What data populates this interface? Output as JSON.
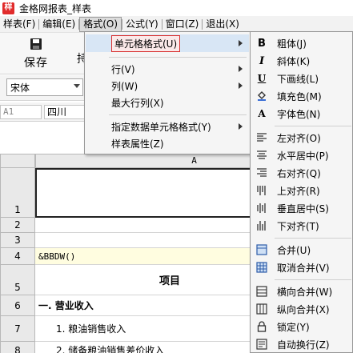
{
  "window": {
    "title": "金格网报表_样表",
    "app_icon_glyph": "样"
  },
  "menubar": {
    "items": [
      {
        "label": "样表(F)"
      },
      {
        "label": "编辑(E)"
      },
      {
        "label": "格式(O)"
      },
      {
        "label": "公式(Y)"
      },
      {
        "label": "窗口(Z)"
      },
      {
        "label": "退出(X)"
      }
    ]
  },
  "toolbar": {
    "save_label": "保存",
    "partial_label": "持"
  },
  "fontbar": {
    "font_value": "宋体"
  },
  "formula_bar": {
    "cell_ref": "A1",
    "formula_value": "四川"
  },
  "sheet": {
    "column_header": "A",
    "rows": [
      {
        "num": "1",
        "text": ""
      },
      {
        "num": "2",
        "text": ""
      },
      {
        "num": "3",
        "text": ""
      },
      {
        "num": "4",
        "text": "&BBDW()"
      },
      {
        "num": "5",
        "text": "项目"
      },
      {
        "num": "6",
        "text": "一. 营业收入"
      },
      {
        "num": "7",
        "text": "1. 粮油销售收入"
      },
      {
        "num": "8",
        "text": "2. 储备粮油销售差价收入"
      }
    ]
  },
  "format_menu": {
    "items": [
      {
        "label": "单元格格式(U)",
        "submenu": true,
        "highlighted": true
      },
      {
        "label": "行(V)",
        "submenu": true
      },
      {
        "label": "列(W)",
        "submenu": true
      },
      {
        "label": "最大行列(X)",
        "submenu": false
      },
      {
        "label": "指定数据单元格格式(Y)",
        "submenu": true
      },
      {
        "label": "样表属性(Z)",
        "submenu": false
      }
    ]
  },
  "cell_format_submenu": {
    "items": [
      {
        "icon": "bold-icon",
        "glyph": "B",
        "label": "粗体(J)"
      },
      {
        "icon": "italic-icon",
        "glyph": "I",
        "label": "斜体(K)"
      },
      {
        "icon": "underline-icon",
        "glyph": "U",
        "label": "下画线(L)"
      },
      {
        "icon": "fill-color-icon",
        "glyph": "",
        "label": "填充色(M)"
      },
      {
        "icon": "font-color-icon",
        "glyph": "A",
        "label": "字体色(N)"
      },
      {
        "icon": "align-left-icon",
        "glyph": "",
        "label": "左对齐(O)"
      },
      {
        "icon": "align-center-icon",
        "glyph": "",
        "label": "水平居中(P)"
      },
      {
        "icon": "align-right-icon",
        "glyph": "",
        "label": "右对齐(Q)"
      },
      {
        "icon": "align-top-icon",
        "glyph": "",
        "label": "上对齐(R)"
      },
      {
        "icon": "align-middle-icon",
        "glyph": "",
        "label": "垂直居中(S)"
      },
      {
        "icon": "align-bottom-icon",
        "glyph": "",
        "label": "下对齐(T)"
      },
      {
        "icon": "merge-icon",
        "glyph": "",
        "label": "合并(U)"
      },
      {
        "icon": "unmerge-icon",
        "glyph": "",
        "label": "取消合并(V)"
      },
      {
        "icon": "merge-horizontal-icon",
        "glyph": "",
        "label": "横向合并(W)"
      },
      {
        "icon": "merge-vertical-icon",
        "glyph": "",
        "label": "纵向合并(X)"
      },
      {
        "icon": "lock-icon",
        "glyph": "",
        "label": "锁定(Y)"
      },
      {
        "icon": "wrap-text-icon",
        "glyph": "",
        "label": "自动换行(Z)"
      }
    ]
  }
}
